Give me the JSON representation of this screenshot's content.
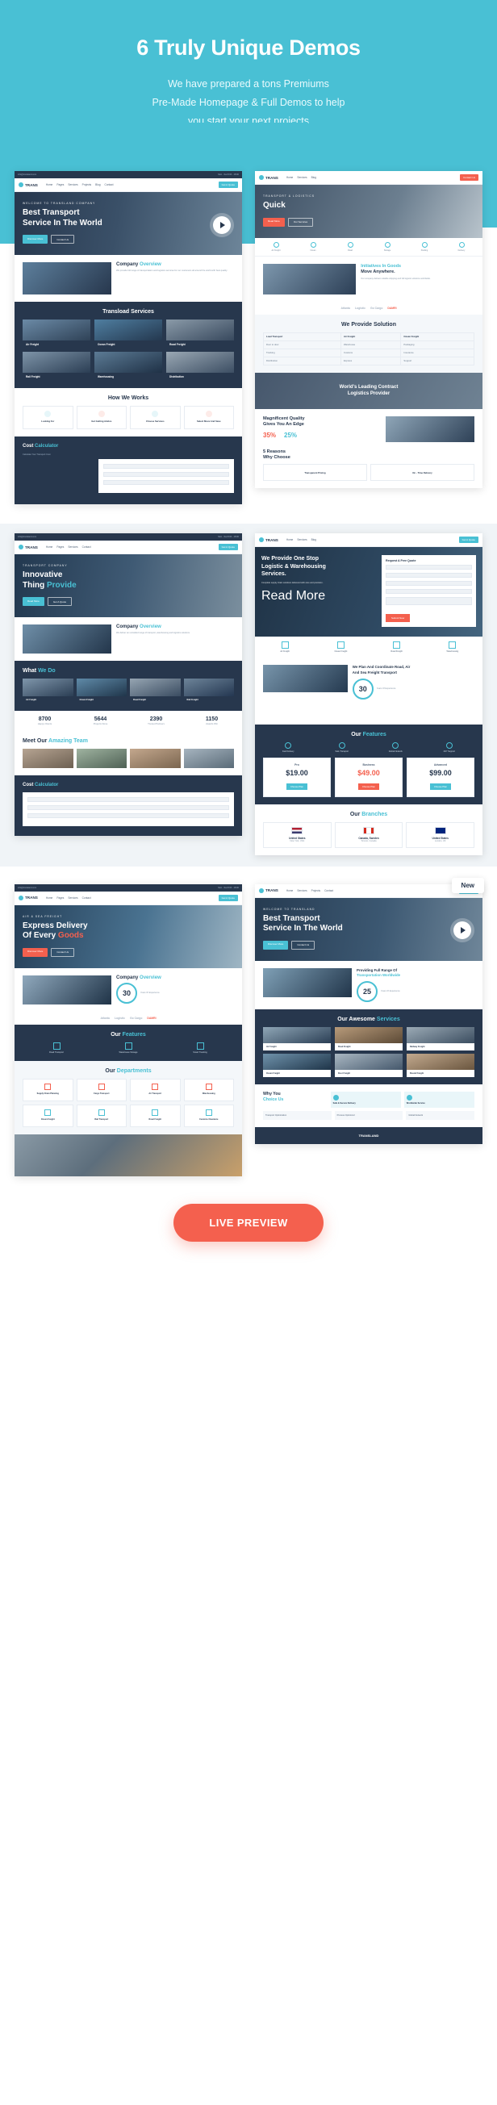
{
  "hero": {
    "title": "6 Truly Unique Demos",
    "line1": "We have prepared a tons Premiums",
    "line2": "Pre-Made Homepage & Full Demos to help",
    "line3": "you start your next projects"
  },
  "brand": {
    "name": "TRANS",
    "name_suffix": "LAND",
    "accent_teal": "#49c0d4",
    "accent_red": "#f4604e",
    "dark_navy": "#27374d"
  },
  "nav": {
    "items": [
      "Home",
      "Pages",
      "Services",
      "Projects",
      "Blog",
      "Contact"
    ],
    "cta": "Get A Quote",
    "cta2": "Contact Us"
  },
  "topbar": {
    "left": "info@transland.com",
    "right": "Mon - Sat 8:00 - 18:00"
  },
  "demos": [
    {
      "id": "demo-1",
      "banner": {
        "sub": "WELCOME TO TRANSLAND COMPANY",
        "title_a": "Best Transport",
        "title_b": "Service In The World",
        "btn1": "Discover More",
        "btn2": "Contact Us"
      },
      "sections": [
        {
          "key": "company-overview",
          "title_a": "Company",
          "title_b": "Overview",
          "text": "We provide full range of transportation and logistics services for our customers all around the world with best quality."
        },
        {
          "key": "transload-services",
          "title": "Transload Services",
          "cards": [
            {
              "label": "Air Freight"
            },
            {
              "label": "Ocean Freight"
            },
            {
              "label": "Road Freight"
            },
            {
              "label": "Rail Freight"
            },
            {
              "label": "Warehousing"
            },
            {
              "label": "Distribution"
            }
          ]
        },
        {
          "key": "how-we-works",
          "title": "How We Works",
          "steps": [
            {
              "t": "Looking For"
            },
            {
              "t": "Get Getting Advice"
            },
            {
              "t": "Choose Services"
            },
            {
              "t": "Select Move And Save"
            }
          ]
        },
        {
          "key": "cost-calculator",
          "title_a": "Cost",
          "title_b": "Calculator",
          "sub": "Calculate Your Transport Cost"
        }
      ]
    },
    {
      "id": "demo-2",
      "banner": {
        "sub": "TRANSPORT & LOGISTICS",
        "title_a": "Quick",
        "btn1": "Read More",
        "btn2": "Our Services"
      },
      "icons_row": [
        "Air Freight",
        "Ocean",
        "Road",
        "Storage",
        "Packing",
        "Delivery"
      ],
      "sections": [
        {
          "key": "initiatives",
          "title_a": "Initiatives In Goods",
          "title_b": "Move Anywhere.",
          "text": "Our company delivers reliable shipping and full logistic solutions worldwide."
        },
        {
          "key": "partner-logos",
          "logos": [
            "Atlanta",
            "Logistic",
            "Go Cargo",
            "DAMRI"
          ]
        },
        {
          "key": "we-provide-solution",
          "title": "We Provide Solution",
          "table": {
            "headers": [
              "Load Transport",
              "Air Freight",
              "Ocean Freight"
            ],
            "rows": [
              [
                "Door to door",
                "Warehouse",
                "Packaging"
              ],
              [
                "Tracking",
                "Customs",
                "Insurance"
              ],
              [
                "Distribution",
                "Express",
                "Support"
              ]
            ]
          }
        },
        {
          "key": "worlds-leading",
          "title_a": "World's Leading Contract",
          "title_b": "Logistics Provider"
        },
        {
          "key": "magnificent-quality",
          "title_a": "Magnificent Quality",
          "title_b": "Gives You An Edge",
          "pct1": "35%",
          "pct2": "25%"
        },
        {
          "key": "5-reasons",
          "title_a": "5 Reasons",
          "title_b": "Why Choose",
          "item1": "Transparent Pricing",
          "item2": "On - Time Delivery"
        }
      ]
    },
    {
      "id": "demo-3",
      "banner": {
        "sub": "TRANSPORT COMPANY",
        "title_a": "Innovative",
        "title_b": "Thing",
        "title_accent": "Provide",
        "btn1": "Read More",
        "btn2": "Get A Quote"
      },
      "sections": [
        {
          "key": "company-overview",
          "title_a": "Company",
          "title_b": "Overview",
          "text": "We deliver an unrivalled range of transport, warehousing and logistics solutions."
        },
        {
          "key": "what-we-do",
          "title_a": "What",
          "title_b": "We Do",
          "cards": [
            {
              "label": "Air Freight"
            },
            {
              "label": "Ocean Freight"
            },
            {
              "label": "Road Freight"
            },
            {
              "label": "Rail Freight"
            }
          ]
        },
        {
          "key": "counters",
          "stats": [
            {
              "n": "8700",
              "l": "Happy Clients"
            },
            {
              "n": "5644",
              "l": "Projects Done"
            },
            {
              "n": "2390",
              "l": "Trusted Partners"
            },
            {
              "n": "1150",
              "l": "Awards Win"
            }
          ]
        },
        {
          "key": "meet-team",
          "title_a": "Meet Our",
          "title_b": "Amazing Team"
        },
        {
          "key": "cost-calculator",
          "title_a": "Cost",
          "title_b": "Calculator",
          "sub": "Calculate Your Transport Cost"
        }
      ]
    },
    {
      "id": "demo-4",
      "banner": {
        "title_a": "We Provide One Stop",
        "title_b": "Logistic & Warehousing",
        "title_c": "Services.",
        "text": "Complete supply chain solutions delivered with care and precision.",
        "btn": "Read More"
      },
      "quote_form": {
        "title": "Request A Free Quote",
        "fields": [
          "Your Name",
          "Email Address",
          "Phone Number",
          "Service Type",
          "Message"
        ],
        "submit": "Submit Now"
      },
      "sections": [
        {
          "key": "service-icons",
          "items": [
            "Air Freight",
            "Ocean Freight",
            "Road Freight",
            "Warehousing"
          ]
        },
        {
          "key": "coordinate",
          "title_a": "We Plan And Coordinate Road, Air",
          "title_b": "And Sea Freight Transport",
          "number": "30",
          "number_label": "Years Of Experience",
          "btn": "Read More"
        },
        {
          "key": "our-features",
          "title_a": "Our",
          "title_b": "Features",
          "features": [
            "Fast Delivery",
            "Safe Transport",
            "Global Network",
            "24/7 Support"
          ],
          "pricing": [
            {
              "name": "Pro",
              "price": "$19.00",
              "active": false,
              "btn": "Choose Plan"
            },
            {
              "name": "Business",
              "price": "$49.00",
              "active": true,
              "btn": "Choose Plan"
            },
            {
              "name": "Advanced",
              "price": "$99.00",
              "active": false,
              "btn": "Choose Plan"
            }
          ]
        },
        {
          "key": "our-branches",
          "title_a": "Our",
          "title_b": "Branches",
          "branches": [
            {
              "name": "United States",
              "addr": "New York, USA"
            },
            {
              "name": "Canada, Sweden",
              "addr": "Toronto, Canada"
            },
            {
              "name": "United States",
              "addr": "London, UK"
            }
          ]
        }
      ]
    },
    {
      "id": "demo-5",
      "banner": {
        "sub": "AIR & SEA FREIGHT",
        "title_a": "Express Delivery",
        "title_b": "Of Every",
        "title_accent": "Goods",
        "btn1": "Discover More",
        "btn2": "Contact Us"
      },
      "sections": [
        {
          "key": "company-overview",
          "title_a": "Company",
          "title_b": "Overview",
          "number": "30",
          "number_label": "Years Of Experience"
        },
        {
          "key": "partner-logos",
          "logos": [
            "Atlanta",
            "Logistic",
            "Go Cargo",
            "DAMRI"
          ]
        },
        {
          "key": "our-features",
          "title_a": "Our",
          "title_b": "Features",
          "features": [
            "Road Transport",
            "Warehouse Storage",
            "Smart Tracking"
          ]
        },
        {
          "key": "our-departments",
          "title_a": "Our",
          "title_b": "Departments",
          "departments": [
            "Supply Chain Planning",
            "Cargo Transport",
            "Air Transport",
            "Warehousing",
            "Ocean Freight",
            "Rail Transport",
            "Road Freight",
            "Customs Clearance"
          ]
        }
      ]
    },
    {
      "id": "demo-6",
      "badge": "New",
      "banner": {
        "sub": "WELCOME TO TRANSLAND",
        "title_a": "Best Transport",
        "title_b": "Service In The World",
        "btn1": "Discover More",
        "btn2": "Contact Us"
      },
      "sections": [
        {
          "key": "full-range",
          "title_a": "Providing Full Range Of",
          "title_b": "Transportation Worldwide",
          "number": "25",
          "number_label": "Years Of Experience"
        },
        {
          "key": "awesome-services",
          "title_a": "Our Awesome",
          "title_b": "Services",
          "services": [
            "Air Freight",
            "Road Freight",
            "Railway Freight",
            "Ocean Freight",
            "Door Freight",
            "Bound Freight"
          ]
        },
        {
          "key": "why-you-choose-us",
          "title_a": "Why You",
          "title_b": "Choice Us",
          "items": [
            "Safe & Secure Delivery",
            "Worldwide Service",
            "Transport Optimization",
            "Process Optimized",
            "Global Network",
            "Customer Support"
          ]
        }
      ],
      "footer": {
        "brand": "TRANSLAND"
      }
    }
  ],
  "cta": {
    "label": "LIVE PREVIEW"
  }
}
